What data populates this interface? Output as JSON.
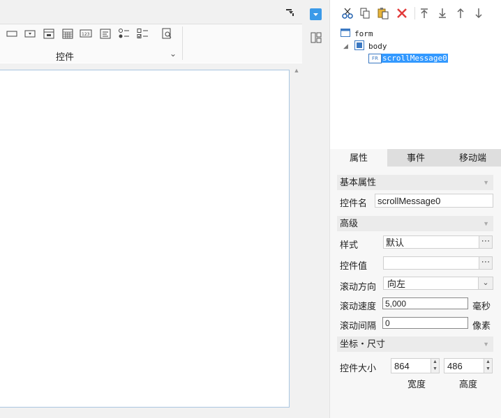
{
  "ribbon": {
    "group_label": "控件",
    "tools": [
      "text-field-icon",
      "dropdown-icon",
      "date-icon",
      "calendar-grid-icon",
      "number-field-icon",
      "text-area-icon",
      "radio-group-icon",
      "checkbox-group-icon",
      "preview-icon"
    ]
  },
  "tree": {
    "nodes": [
      {
        "label": "form",
        "icon": "form-icon"
      },
      {
        "label": "body",
        "icon": "body-icon"
      },
      {
        "label": "scrollMessage0",
        "icon": "fr-widget-icon",
        "badge": "FR"
      }
    ]
  },
  "tabs": [
    "属性",
    "事件",
    "移动端"
  ],
  "active_tab": "属性",
  "sections": {
    "basic": "基本属性",
    "advanced": "高级",
    "coords": "坐标・尺寸"
  },
  "properties": {
    "widget_name_label": "控件名",
    "widget_name_value": "scrollMessage0",
    "style_label": "样式",
    "style_value": "默认",
    "widget_value_label": "控件值",
    "widget_value_value": "",
    "scroll_dir_label": "滚动方向",
    "scroll_dir_value": "向左",
    "scroll_speed_label": "滚动速度",
    "scroll_speed_value": "5,000",
    "scroll_speed_unit": "毫秒",
    "scroll_gap_label": "滚动间隔",
    "scroll_gap_value": "0",
    "scroll_gap_unit": "像素",
    "size_label": "控件大小",
    "width_value": "864",
    "height_value": "486",
    "width_caption": "宽度",
    "height_caption": "高度"
  },
  "colors": {
    "accent": "#3b9ae8",
    "selection": "#3399ff",
    "delete": "#e23b3b",
    "canvas_border": "#a9c6e0"
  }
}
